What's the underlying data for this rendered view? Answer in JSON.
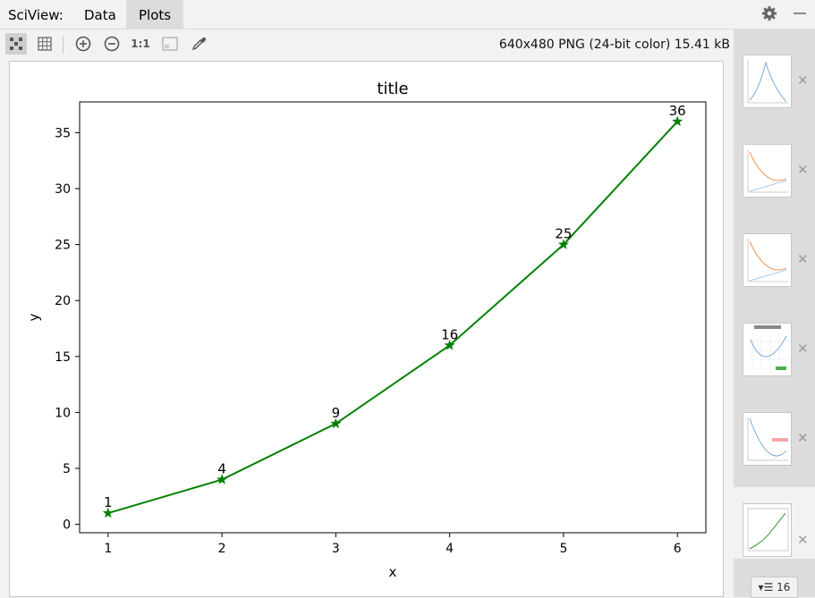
{
  "header": {
    "tool_title": "SciView:",
    "tabs": [
      "Data",
      "Plots"
    ],
    "active_tab": "Plots"
  },
  "toolbar": {
    "buttons": [
      "fit-view-icon",
      "grid-icon",
      "zoom-in-icon",
      "zoom-out-icon",
      "actual-size-icon",
      "background-icon",
      "color-picker-icon"
    ],
    "ratio_label": "1:1",
    "image_info": "640x480 PNG (24-bit color) 15.41 kB"
  },
  "sidebar": {
    "thumbnails": [
      {
        "index": 1,
        "selected": false
      },
      {
        "index": 2,
        "selected": false
      },
      {
        "index": 3,
        "selected": false
      },
      {
        "index": 4,
        "selected": false
      },
      {
        "index": 5,
        "selected": false
      },
      {
        "index": 6,
        "selected": true
      }
    ],
    "count_label": "16"
  },
  "colors": {
    "line": "#008000",
    "axes": "#000000"
  },
  "chart_data": {
    "type": "line",
    "title": "title",
    "xlabel": "x",
    "ylabel": "y",
    "x": [
      1,
      2,
      3,
      4,
      5,
      6
    ],
    "y": [
      1,
      4,
      9,
      16,
      25,
      36
    ],
    "point_labels": [
      "1",
      "4",
      "9",
      "16",
      "25",
      "36"
    ],
    "marker": "star",
    "xlim": [
      0.75,
      6.25
    ],
    "ylim": [
      -0.75,
      37.75
    ],
    "xticks": [
      1,
      2,
      3,
      4,
      5,
      6
    ],
    "yticks": [
      0,
      5,
      10,
      15,
      20,
      25,
      30,
      35
    ],
    "grid": false
  }
}
